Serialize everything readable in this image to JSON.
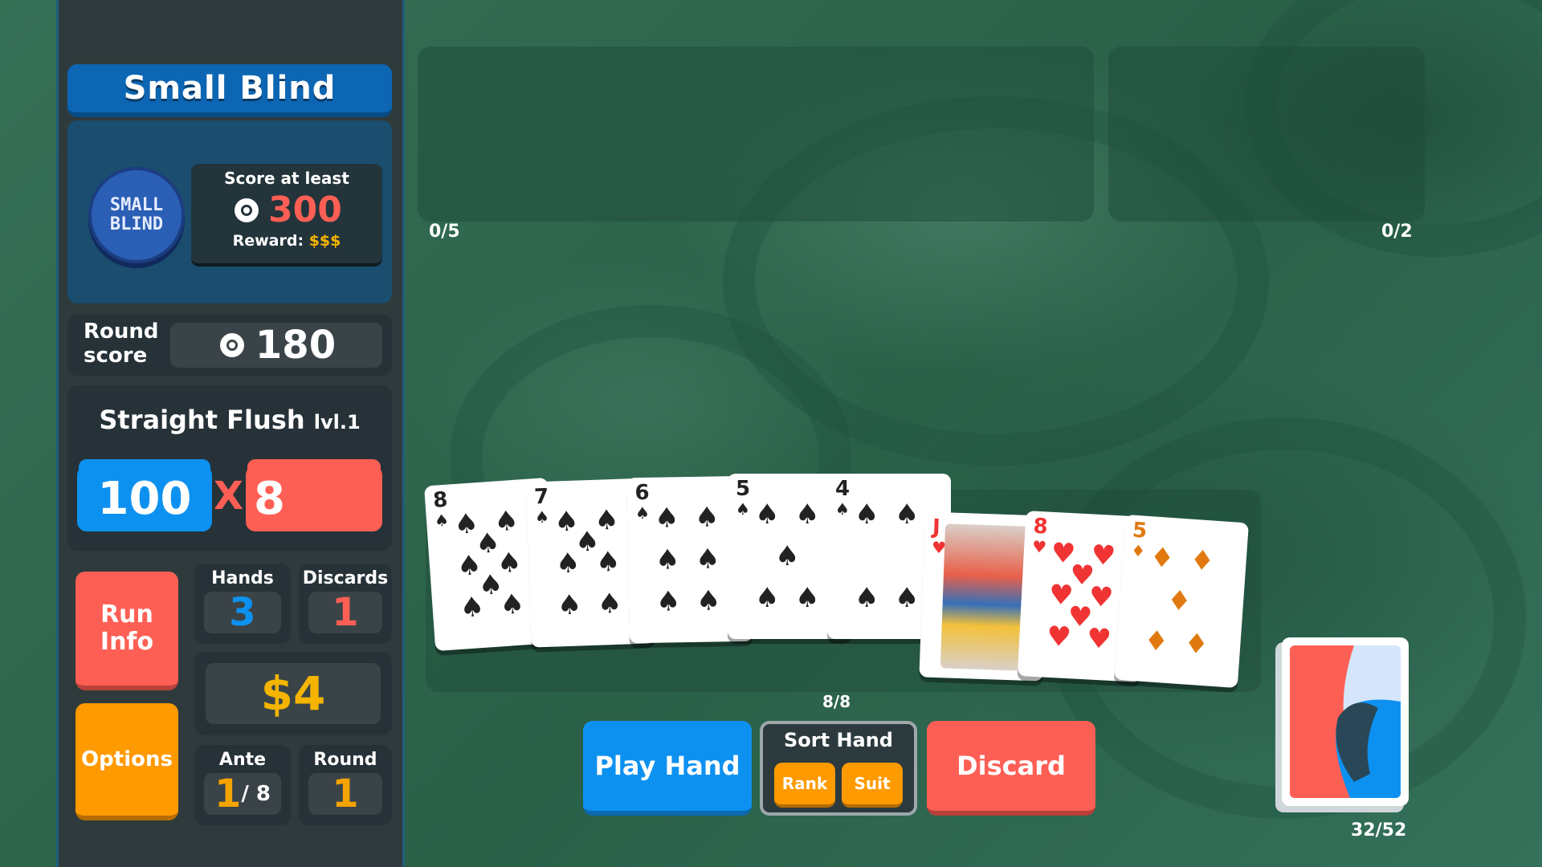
{
  "blind": {
    "title": "Small Blind",
    "chip_line1": "SMALL",
    "chip_line2": "BLIND",
    "score_label": "Score at least",
    "target_score": "300",
    "reward_label": "Reward:",
    "reward_value": "$$$"
  },
  "round": {
    "label_line1": "Round",
    "label_line2": "score",
    "score": "180"
  },
  "hand_type": {
    "name": "Straight Flush",
    "level": "lvl.1",
    "chips": "100",
    "times": "X",
    "mult": "8"
  },
  "buttons": {
    "run_info_line1": "Run",
    "run_info_line2": "Info",
    "options": "Options",
    "play_hand": "Play Hand",
    "sort_hand": "Sort Hand",
    "sort_rank": "Rank",
    "sort_suit": "Suit",
    "discard": "Discard"
  },
  "stats": {
    "hands_label": "Hands",
    "hands_value": "3",
    "discards_label": "Discards",
    "discards_value": "1",
    "money": "$4",
    "ante_label": "Ante",
    "ante_value": "1",
    "ante_max": "/ 8",
    "round_label": "Round",
    "round_value": "1"
  },
  "slots": {
    "jokers_count": "0/5",
    "consumables_count": "0/2"
  },
  "hand_cards": [
    {
      "rank": "8",
      "suit": "♠",
      "color": "black"
    },
    {
      "rank": "7",
      "suit": "♠",
      "color": "black"
    },
    {
      "rank": "6",
      "suit": "♠",
      "color": "black"
    },
    {
      "rank": "5",
      "suit": "♠",
      "color": "black"
    },
    {
      "rank": "4",
      "suit": "♠",
      "color": "black"
    },
    {
      "rank": "J",
      "suit": "♥",
      "color": "red"
    },
    {
      "rank": "8",
      "suit": "♥",
      "color": "red"
    },
    {
      "rank": "5",
      "suit": "♦",
      "color": "orange"
    }
  ],
  "hand_size": "8/8",
  "deck_count": "32/52",
  "colors": {
    "chips_blue": "#0d91f0",
    "mult_red": "#fe5f55",
    "money_gold": "#f5b400",
    "felt_green": "#2f6a52"
  }
}
